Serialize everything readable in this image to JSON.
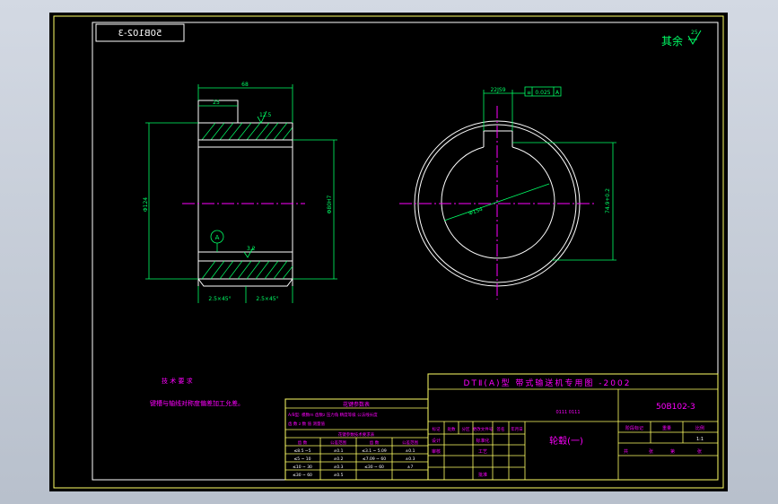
{
  "drawing": {
    "number_mirrored": "50B102-3",
    "roughness_note": "其余",
    "roughness_value": "25",
    "tech_requirements_title": "技 术 要 求",
    "tech_requirements_text": "键槽与轴线对称度偏差加工允差。",
    "dims": {
      "width_total": "68",
      "keyway_width": "25",
      "roughness_top": "12.5",
      "roughness_bore": "3.2",
      "outer_diameter": "Φ124",
      "bore_diameter": "Φ80H7",
      "datum": "A",
      "chamfer_left": "2.5×45°",
      "chamfer_right": "2.5×45°",
      "key_width_right": "22JS9",
      "tolerance_frame": "0.025",
      "tolerance_datum": "A",
      "keyway_depth": "74.9+0.2",
      "diameter_callout": "Φ154"
    },
    "param_table": {
      "title": "花键参数表",
      "notes": [
        "A/B型: 模数m  齿数z  压力角 精度等级  公法线长度",
        "齿 数  z  数 值  测量值"
      ],
      "subtitle": "花键参数技术要求表",
      "header": [
        "齿 数",
        "公差范围",
        "齿 数",
        "公差范围"
      ],
      "rows": [
        [
          "≤8.5 ~5",
          "±0.1",
          "≤3.1 ~ 5.09",
          "±0.1"
        ],
        [
          "≤5 ~ 10",
          "±0.2",
          "≤7.09 ~ 60",
          "±0.3"
        ],
        [
          "≤10 ~ 30",
          "±0.3",
          "≤30 ~ 60",
          "±7"
        ],
        [
          "≤30 ~ 60",
          "±0.5",
          "",
          ""
        ]
      ]
    },
    "title_block": {
      "project": "DTⅡ(A)型 带式输送机专用图 -2002",
      "code_small": "0111 0111",
      "drawing_no": "50B102-3",
      "part_name": "轮毂(一)",
      "rev_headers": [
        "标记",
        "处数",
        "分区",
        "更改文件号",
        "签名",
        "年月日"
      ],
      "row_design": [
        "设计",
        "",
        "标准化"
      ],
      "row_check": [
        "审核",
        "",
        "工艺"
      ],
      "row_approve": [
        "",
        "",
        "批准"
      ],
      "stage_headers": [
        "阶段标记",
        "重量",
        "比例"
      ],
      "stage_values": [
        "",
        "",
        "1:1"
      ],
      "sheet_row": [
        "共",
        "张",
        "第",
        "张"
      ]
    }
  }
}
